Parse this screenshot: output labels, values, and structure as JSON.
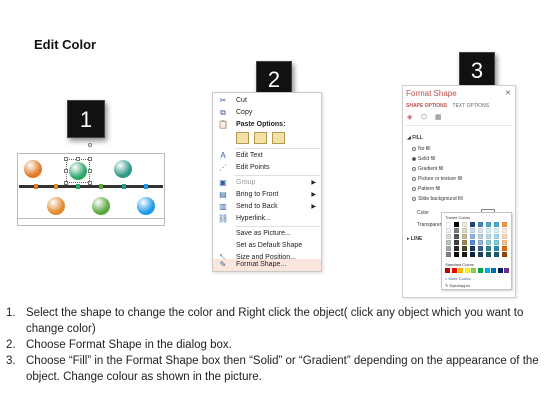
{
  "title": "Edit Color",
  "badges": [
    "1",
    "2",
    "3"
  ],
  "shapes": {
    "top_circles": [
      "#e07b2a",
      "#2ea66a",
      "#2e9a86"
    ],
    "bottom_circles": [
      "#e08a2e",
      "#5aa83f",
      "#1e9be8"
    ]
  },
  "context_menu": {
    "items": [
      {
        "label": "Cut",
        "icon": "scissors-icon",
        "glyph": "✂"
      },
      {
        "label": "Copy",
        "icon": "copy-icon",
        "glyph": "⧉"
      },
      {
        "label": "Paste Options:",
        "icon": "paste-icon",
        "glyph": "📋",
        "bold": true
      },
      {
        "label": "Edit Text",
        "icon": "edit-text-icon",
        "glyph": "A"
      },
      {
        "label": "Edit Points",
        "icon": "edit-points-icon",
        "glyph": "⋰"
      },
      {
        "label": "Group",
        "icon": "group-icon",
        "glyph": "▣",
        "disabled": true,
        "submenu": true
      },
      {
        "label": "Bring to Front",
        "icon": "bring-front-icon",
        "glyph": "▤",
        "submenu": true
      },
      {
        "label": "Send to Back",
        "icon": "send-back-icon",
        "glyph": "▥",
        "submenu": true
      },
      {
        "label": "Hyperlink...",
        "icon": "hyperlink-icon",
        "glyph": "⛓"
      },
      {
        "label": "Save as Picture...",
        "icon": "",
        "glyph": ""
      },
      {
        "label": "Set as Default Shape",
        "icon": "",
        "glyph": ""
      },
      {
        "label": "Size and Position...",
        "icon": "size-position-icon",
        "glyph": "⤡"
      },
      {
        "label": "Format Shape...",
        "icon": "format-shape-icon",
        "glyph": "✎",
        "highlighted": true
      }
    ]
  },
  "format_pane": {
    "title": "Format Shape",
    "close": "✕",
    "tab_shape": "SHAPE OPTIONS",
    "tab_text": "TEXT OPTIONS",
    "fill_section": "FILL",
    "fill_options": [
      "No fill",
      "Solid fill",
      "Gradient fill",
      "Picture or texture fill",
      "Pattern fill",
      "Slide background fill"
    ],
    "selected_fill": "Solid fill",
    "color_label": "Color",
    "transparency_label": "Transparen",
    "line_section": "LINE",
    "palette": {
      "theme_label": "Theme Colors",
      "standard_label": "Standard Colors",
      "more_colors": "More Colors...",
      "eyedropper": "Eyedropper",
      "theme_columns": [
        [
          "#ffffff",
          "#f2f2f2",
          "#d9d9d9",
          "#bfbfbf",
          "#a6a6a6",
          "#808080"
        ],
        [
          "#000000",
          "#7f7f7f",
          "#595959",
          "#404040",
          "#262626",
          "#0d0d0d"
        ],
        [
          "#eeece1",
          "#ddd9c3",
          "#c4bd97",
          "#948a54",
          "#4a452a",
          "#1d1b10"
        ],
        [
          "#1f497d",
          "#c6d9f0",
          "#8db3e2",
          "#548dd4",
          "#17365d",
          "#0f243e"
        ],
        [
          "#4f81bd",
          "#dbe5f1",
          "#b8cce4",
          "#95b3d7",
          "#366092",
          "#244061"
        ],
        [
          "#4bacc6",
          "#daeef3",
          "#b7dde8",
          "#92cddc",
          "#31859b",
          "#205867"
        ],
        [
          "#4bacc6",
          "#d8f0f5",
          "#a5dbe8",
          "#7ccbe0",
          "#2a8aa6",
          "#1b5c6e"
        ],
        [
          "#f79646",
          "#fdeada",
          "#fbd5b5",
          "#fac08f",
          "#e36c09",
          "#974806"
        ]
      ],
      "standard": [
        "#c00000",
        "#ff0000",
        "#ffc000",
        "#ffff00",
        "#92d050",
        "#00b050",
        "#00b0f0",
        "#0070c0",
        "#002060",
        "#7030a0"
      ]
    }
  },
  "instructions": [
    {
      "num": "1.",
      "text": "Select the shape to change the color and Right click the object( click any object which you want to change color)"
    },
    {
      "num": "2.",
      "text": "Choose Format Shape in the dialog box."
    },
    {
      "num": "3.",
      "text": "Choose “Fill” in the Format Shape box then “Solid” or “Gradient” depending on the appearance of the object. Change colour as shown in the picture."
    }
  ]
}
